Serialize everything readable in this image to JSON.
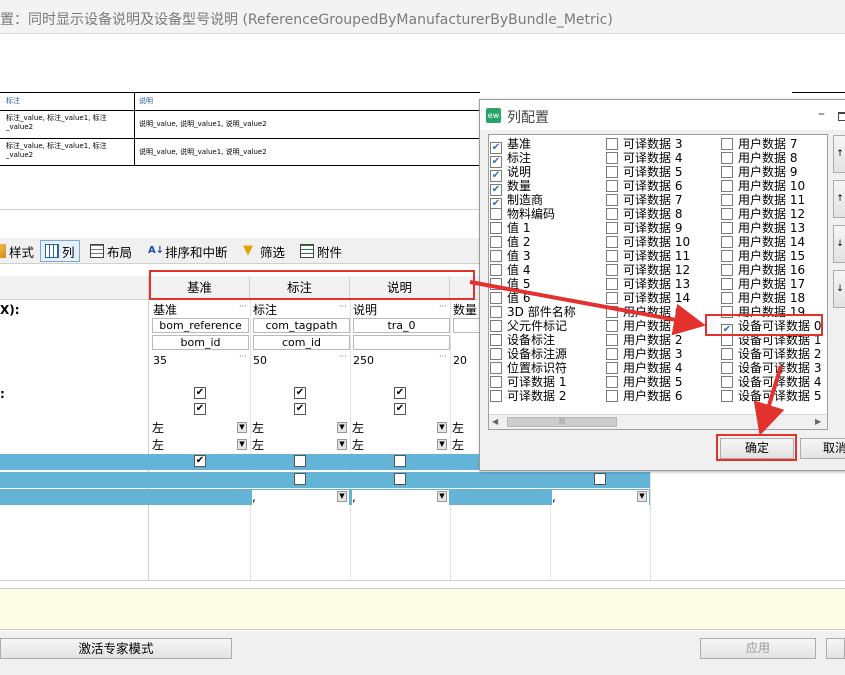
{
  "title": "置：同时显示设备说明及设备型号说明 (ReferenceGroupedByManufacturerByBundle_Metric)",
  "preview": {
    "headers": [
      "标注",
      "说明"
    ],
    "rows": [
      [
        "标注_value, 标注_value1, 标注_value2",
        "说明_value, 说明_value1, 说明_value2"
      ],
      [
        "标注_value, 标注_value1, 标注_value2",
        "说明_value, 说明_value1, 说明_value2"
      ]
    ]
  },
  "tabs": [
    {
      "label": "样式",
      "icon": "style-icon"
    },
    {
      "label": "列",
      "icon": "columns-icon"
    },
    {
      "label": "布局",
      "icon": "layout-icon"
    },
    {
      "label": "排序和中断",
      "icon": "sort-icon"
    },
    {
      "label": "筛选",
      "icon": "filter-icon"
    },
    {
      "label": "附件",
      "icon": "attachment-icon"
    }
  ],
  "editor": {
    "row_label_fragment": "X):",
    "row_label_fragment2": "示：",
    "header_cells": [
      "基准",
      "标注",
      "说明"
    ],
    "columns": [
      {
        "name": "基准",
        "prop": "bom_reference",
        "id": "bom_id",
        "width": "35",
        "align1": "左",
        "align2": "左"
      },
      {
        "name": "标注",
        "prop": "com_tagpath",
        "id": "com_id",
        "width": "50",
        "align1": "左",
        "align2": "左"
      },
      {
        "name": "说明",
        "prop": "tra_0",
        "id": "",
        "width": "250",
        "align1": "左",
        "align2": "左"
      },
      {
        "name": "数量",
        "prop": "",
        "id": "",
        "width": "20",
        "align1": "左",
        "align2": "左"
      }
    ],
    "comma": ",",
    "ellipsis": "···"
  },
  "expert_button": "激活专家模式",
  "apply_button": "应用",
  "dialog": {
    "title": "列配置",
    "icon_text": "ew",
    "col1": [
      {
        "label": "基准",
        "checked": true
      },
      {
        "label": "标注",
        "checked": true
      },
      {
        "label": "说明",
        "checked": true
      },
      {
        "label": "数量",
        "checked": true
      },
      {
        "label": "制造商",
        "checked": true
      },
      {
        "label": "物料编码",
        "checked": false
      },
      {
        "label": "值 1",
        "checked": false
      },
      {
        "label": "值 2",
        "checked": false
      },
      {
        "label": "值 3",
        "checked": false
      },
      {
        "label": "值 4",
        "checked": false
      },
      {
        "label": "值 5",
        "checked": false
      },
      {
        "label": "值 6",
        "checked": false
      },
      {
        "label": "3D 部件名称",
        "checked": false
      },
      {
        "label": "父元件标记",
        "checked": false
      },
      {
        "label": "设备标注",
        "checked": false
      },
      {
        "label": "设备标注源",
        "checked": false
      },
      {
        "label": "位置标识符",
        "checked": false
      },
      {
        "label": "可译数据 1",
        "checked": false
      },
      {
        "label": "可译数据 2",
        "checked": false
      }
    ],
    "col2": [
      {
        "label": "可译数据 3",
        "checked": false
      },
      {
        "label": "可译数据 4",
        "checked": false
      },
      {
        "label": "可译数据 5",
        "checked": false
      },
      {
        "label": "可译数据 6",
        "checked": false
      },
      {
        "label": "可译数据 7",
        "checked": false
      },
      {
        "label": "可译数据 8",
        "checked": false
      },
      {
        "label": "可译数据 9",
        "checked": false
      },
      {
        "label": "可译数据 10",
        "checked": false
      },
      {
        "label": "可译数据 11",
        "checked": false
      },
      {
        "label": "可译数据 12",
        "checked": false
      },
      {
        "label": "可译数据 13",
        "checked": false
      },
      {
        "label": "可译数据 14",
        "checked": false
      },
      {
        "label": "用户数据 0",
        "checked": false
      },
      {
        "label": "用户数据 1",
        "checked": false
      },
      {
        "label": "用户数据 2",
        "checked": false
      },
      {
        "label": "用户数据 3",
        "checked": false
      },
      {
        "label": "用户数据 4",
        "checked": false
      },
      {
        "label": "用户数据 5",
        "checked": false
      },
      {
        "label": "用户数据 6",
        "checked": false
      }
    ],
    "col3": [
      {
        "label": "用户数据 7",
        "checked": false
      },
      {
        "label": "用户数据 8",
        "checked": false
      },
      {
        "label": "用户数据 9",
        "checked": false
      },
      {
        "label": "用户数据 10",
        "checked": false
      },
      {
        "label": "用户数据 11",
        "checked": false
      },
      {
        "label": "用户数据 12",
        "checked": false
      },
      {
        "label": "用户数据 13",
        "checked": false
      },
      {
        "label": "用户数据 14",
        "checked": false
      },
      {
        "label": "用户数据 15",
        "checked": false
      },
      {
        "label": "用户数据 16",
        "checked": false
      },
      {
        "label": "用户数据 17",
        "checked": false
      },
      {
        "label": "用户数据 18",
        "checked": false
      },
      {
        "label": "用户数据 19",
        "checked": false
      },
      {
        "label": "设备可译数据 0",
        "checked": true
      },
      {
        "label": "设备可译数据 1",
        "checked": false
      },
      {
        "label": "设备可译数据 2",
        "checked": false
      },
      {
        "label": "设备可译数据 3",
        "checked": false
      },
      {
        "label": "设备可译数据 4",
        "checked": false
      },
      {
        "label": "设备可译数据 5",
        "checked": false
      }
    ],
    "ok_button": "确定",
    "cancel_button": "取消",
    "scroll_glyph": "|||"
  },
  "colors": {
    "highlight_red": "#e3312d",
    "row_blue": "#63b4d6",
    "checked_blue": "#3a6fb5"
  }
}
